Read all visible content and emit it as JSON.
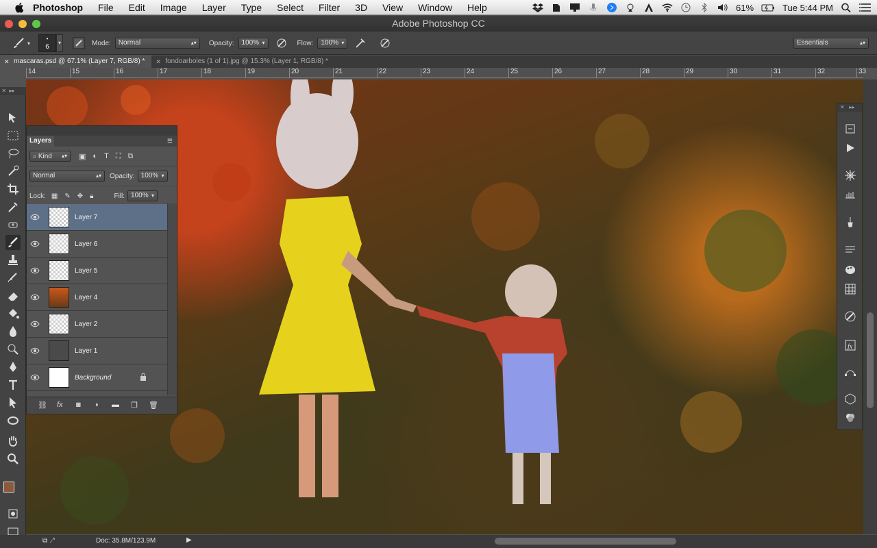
{
  "menubar": {
    "apple_icon": "apple-icon",
    "items": [
      "Photoshop",
      "File",
      "Edit",
      "Image",
      "Layer",
      "Type",
      "Select",
      "Filter",
      "3D",
      "View",
      "Window",
      "Help"
    ],
    "battery": "61%",
    "clock": "Tue 5:44 PM"
  },
  "window": {
    "title": "Adobe Photoshop CC"
  },
  "options": {
    "brush_size": "6",
    "mode_label": "Mode:",
    "mode_value": "Normal",
    "opacity_label": "Opacity:",
    "opacity_value": "100%",
    "flow_label": "Flow:",
    "flow_value": "100%",
    "workspace": "Essentials"
  },
  "tabs": [
    {
      "label": "mascaras.psd @ 67.1% (Layer 7, RGB/8) *",
      "active": true
    },
    {
      "label": "fondoarboles (1 of 1).jpg @ 15.3% (Layer 1, RGB/8) *",
      "active": false
    }
  ],
  "ruler": {
    "ticks": [
      "14",
      "15",
      "16",
      "17",
      "18",
      "19",
      "20",
      "21",
      "22",
      "23",
      "24",
      "25",
      "26",
      "27",
      "28",
      "29",
      "30",
      "31",
      "32",
      "33"
    ]
  },
  "layers_panel": {
    "tab_label": "Layers",
    "kind_label": "Kind",
    "blend_mode": "Normal",
    "opacity_label": "Opacity:",
    "opacity_value": "100%",
    "lock_label": "Lock:",
    "fill_label": "Fill:",
    "fill_value": "100%",
    "layers": [
      {
        "name": "Layer 7",
        "active": true
      },
      {
        "name": "Layer 6",
        "active": false
      },
      {
        "name": "Layer 5",
        "active": false
      },
      {
        "name": "Layer 4",
        "active": false
      },
      {
        "name": "Layer 2",
        "active": false
      },
      {
        "name": "Layer 1",
        "active": false
      },
      {
        "name": "Background",
        "active": false,
        "locked": true
      }
    ]
  },
  "status": {
    "doc": "Doc: 35.8M/123.9M"
  },
  "colors": {
    "foreground": "#8b5a3c",
    "background": "#c9905d",
    "accent": "#5e7087"
  }
}
